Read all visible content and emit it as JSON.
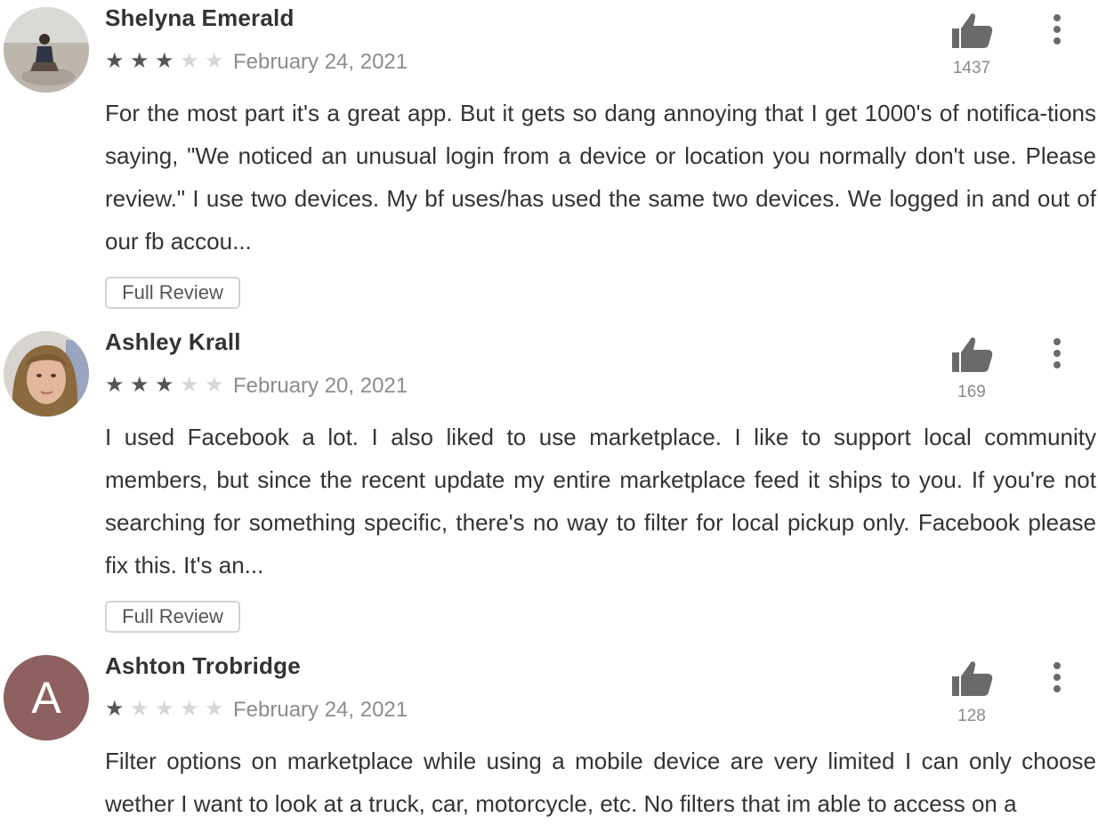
{
  "reviews": [
    {
      "name": "Shelyna Emerald",
      "rating": 3,
      "max_rating": 5,
      "date": "February 24, 2021",
      "likes": "1437",
      "text": "For the most part it's a great app. But it gets so dang annoying that I get 1000's of notifica-tions saying, \"We noticed an unusual login from a device or location you normally don't use. Please review.\" I use two devices. My bf uses/has used the same two devices. We logged in and out of our fb accou...",
      "button": "Full Review",
      "avatar": "photo"
    },
    {
      "name": "Ashley Krall",
      "rating": 3,
      "max_rating": 5,
      "date": "February 20, 2021",
      "likes": "169",
      "text": "I used Facebook a lot. I also liked to use marketplace. I like to support local community members, but since the recent update my entire marketplace feed it ships to you. If you're not searching for something specific, there's no way to filter for local pickup only. Facebook please fix this. It's an...",
      "button": "Full Review",
      "avatar": "photo"
    },
    {
      "name": "Ashton Trobridge",
      "rating": 1,
      "max_rating": 5,
      "date": "February 24, 2021",
      "likes": "128",
      "text": "Filter options on marketplace while using a mobile device are very limited I can only choose wether I want to look at a truck, car, motorcycle, etc. No filters that im able to access on a",
      "avatar": "letter",
      "avatar_letter": "A",
      "avatar_color": "#8e6060"
    }
  ],
  "icons": {
    "like": "thumbs-up-icon",
    "more": "more-vertical-icon",
    "star": "star-icon"
  },
  "colors": {
    "text": "#333333",
    "muted": "#8c8c8c",
    "star_filled": "#555555",
    "star_empty": "#d6d6d6",
    "icon": "#6a6a6a"
  }
}
